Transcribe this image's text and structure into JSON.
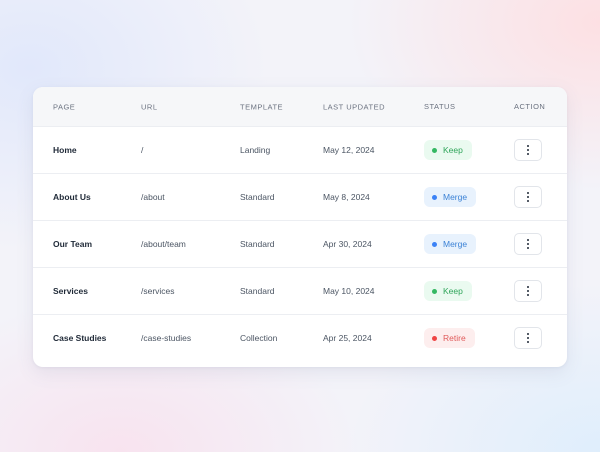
{
  "table": {
    "headers": {
      "page": "PAGE",
      "url": "URL",
      "template": "TEMPLATE",
      "last_updated": "LAST UPDATED",
      "status": "STATUS",
      "action": "ACTION"
    },
    "rows": [
      {
        "page": "Home",
        "url": "/",
        "template": "Landing",
        "last_updated": "May 12, 2024",
        "status": "Keep",
        "status_color": "#34b862"
      },
      {
        "page": "About Us",
        "url": "/about",
        "template": "Standard",
        "last_updated": "May 8, 2024",
        "status": "Merge",
        "status_color": "#3b82f6"
      },
      {
        "page": "Our Team",
        "url": "/about/team",
        "template": "Standard",
        "last_updated": "Apr 30, 2024",
        "status": "Merge",
        "status_color": "#3b82f6"
      },
      {
        "page": "Services",
        "url": "/services",
        "template": "Standard",
        "last_updated": "May 10, 2024",
        "status": "Keep",
        "status_color": "#34b862"
      },
      {
        "page": "Case Studies",
        "url": "/case-studies",
        "template": "Collection",
        "last_updated": "Apr 25, 2024",
        "status": "Retire",
        "status_color": "#ef4444"
      }
    ],
    "action_icon": "more-vertical-icon"
  }
}
